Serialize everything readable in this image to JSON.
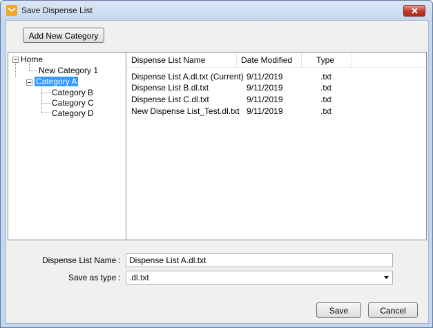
{
  "window": {
    "title": "Save Dispense List"
  },
  "toolbar": {
    "add_category_label": "Add New Category"
  },
  "tree": {
    "nodes": [
      {
        "label": "Home"
      },
      {
        "label": "New Category 1"
      },
      {
        "label": "Category A",
        "selected": true
      },
      {
        "label": "Category B"
      },
      {
        "label": "Category C"
      },
      {
        "label": "Category D"
      }
    ]
  },
  "list": {
    "columns": [
      "Dispense List Name",
      "Date Modified",
      "Type"
    ],
    "rows": [
      {
        "name": "Dispense List A.dl.txt (Current)",
        "date": "9/11/2019",
        "type": ".txt"
      },
      {
        "name": "Dispense List B.dl.txt",
        "date": "9/11/2019",
        "type": ".txt"
      },
      {
        "name": "Dispense List C.dl.txt",
        "date": "9/11/2019",
        "type": ".txt"
      },
      {
        "name": "New Dispense List_Test.dl.txt",
        "date": "9/11/2019",
        "type": ".txt"
      }
    ]
  },
  "form": {
    "name_label": "Dispense List Name :",
    "name_value": "Dispense List A.dl.txt",
    "type_label": "Save as type :",
    "type_value": ".dl.txt"
  },
  "buttons": {
    "save": "Save",
    "cancel": "Cancel"
  },
  "colors": {
    "selection": "#3399ff",
    "close_button": "#c0392b",
    "app_icon": "#f5a623"
  }
}
